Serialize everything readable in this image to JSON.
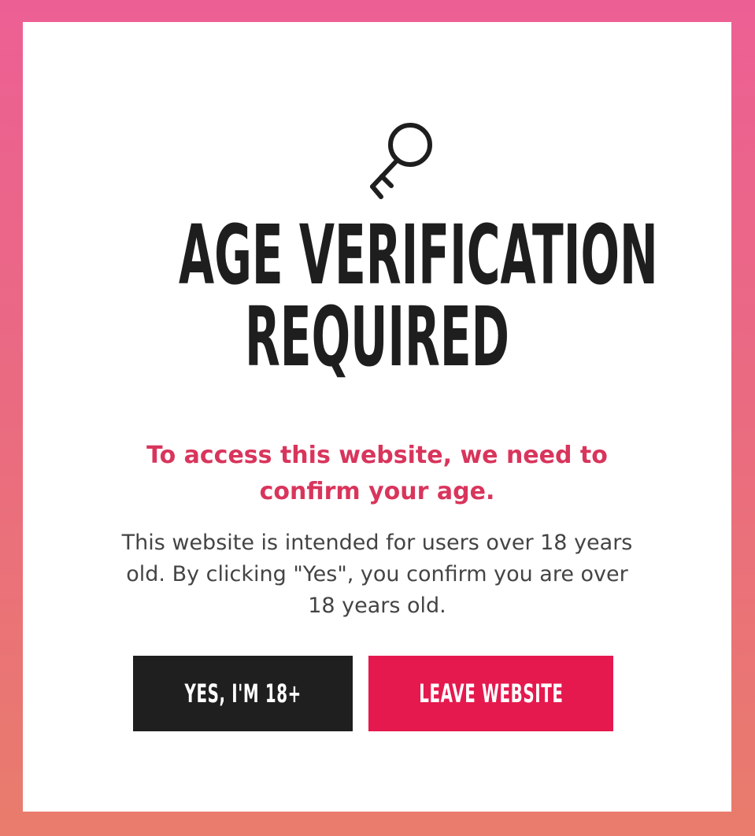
{
  "modal": {
    "icon": "key-icon",
    "title_line1": "AGE VERIFICATION",
    "title_line2": "REQUIRED",
    "lead_line1": "To access this website, we need to",
    "lead_line2": "confirm your age.",
    "body_line1": "This website is intended for users over 18 years",
    "body_line2": "old. By clicking \"Yes\", you confirm you are over",
    "body_line3": "18 years old.",
    "confirm_label": "YES, I'M 18+",
    "leave_label": "LEAVE WEBSITE"
  },
  "colors": {
    "title": "#1e1e1e",
    "lead": "#d9355c",
    "body": "#444444",
    "confirm_bg": "#1f1f1f",
    "leave_bg": "#e5194e",
    "frame_top": "#ec5f94",
    "frame_bottom": "#e97c6c"
  }
}
